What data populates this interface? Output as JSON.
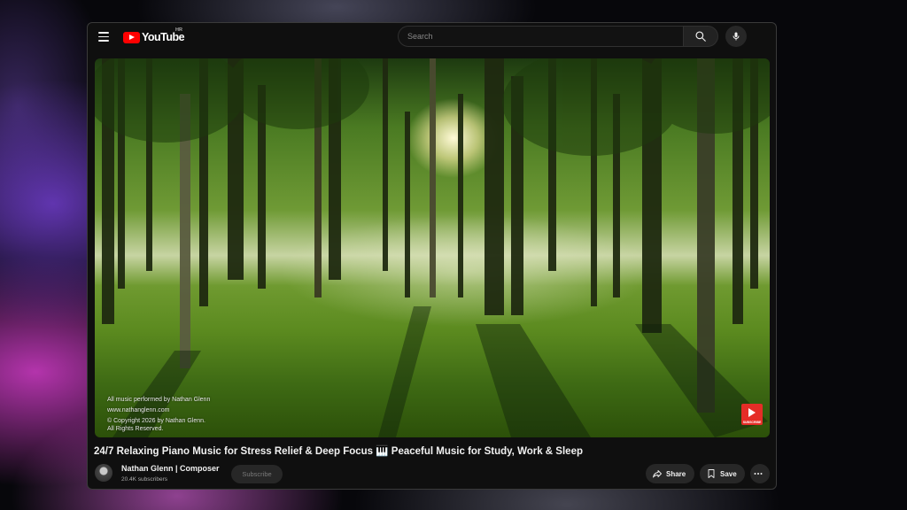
{
  "header": {
    "logo_text": "YouTube",
    "country_code": "HR",
    "search_placeholder": "Search"
  },
  "video": {
    "overlay_lines": [
      "All music performed by Nathan Glenn",
      "www.nathanglenn.com",
      "© Copyright 2026 by Nathan Glenn.",
      "All Rights Reserved."
    ],
    "watermark_label": "SUBSCRIBE"
  },
  "meta": {
    "title": "24/7 Relaxing Piano Music for Stress Relief & Deep Focus 🎹 Peaceful Music for Study, Work & Sleep",
    "channel_name": "Nathan Glenn | Composer",
    "subscribers": "20.4K subscribers",
    "subscribe_label": "Subscribe",
    "share_label": "Share",
    "save_label": "Save"
  },
  "colors": {
    "accent": "#ff0000",
    "background": "#0f0f0f",
    "pill": "#272727"
  },
  "icons": [
    "menu-icon",
    "youtube-logo-icon",
    "search-icon",
    "mic-icon",
    "share-icon",
    "save-icon",
    "more-icon",
    "subscribe-watermark-icon"
  ]
}
